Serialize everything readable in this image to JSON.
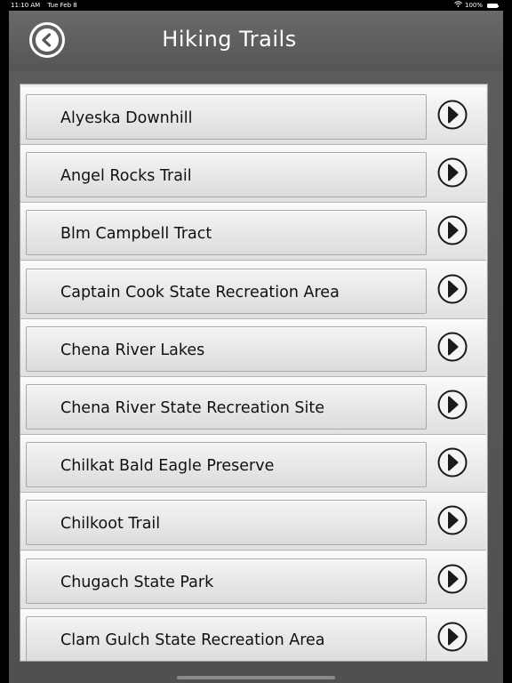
{
  "status_bar": {
    "time": "11:10 AM",
    "date": "Tue Feb 8",
    "battery": "100%"
  },
  "header": {
    "title": "Hiking Trails"
  },
  "trails": [
    "Alyeska Downhill",
    "Angel Rocks Trail",
    "Blm Campbell Tract",
    "Captain Cook State Recreation Area",
    "Chena River Lakes",
    "Chena River State Recreation Site",
    "Chilkat Bald Eagle Preserve",
    "Chilkoot Trail",
    "Chugach State Park",
    "Clam Gulch State Recreation Area"
  ],
  "icons": {
    "back": "back-circle-icon",
    "row_arrow": "chevron-right-circle-icon",
    "wifi": "wifi-icon",
    "battery": "battery-icon"
  }
}
